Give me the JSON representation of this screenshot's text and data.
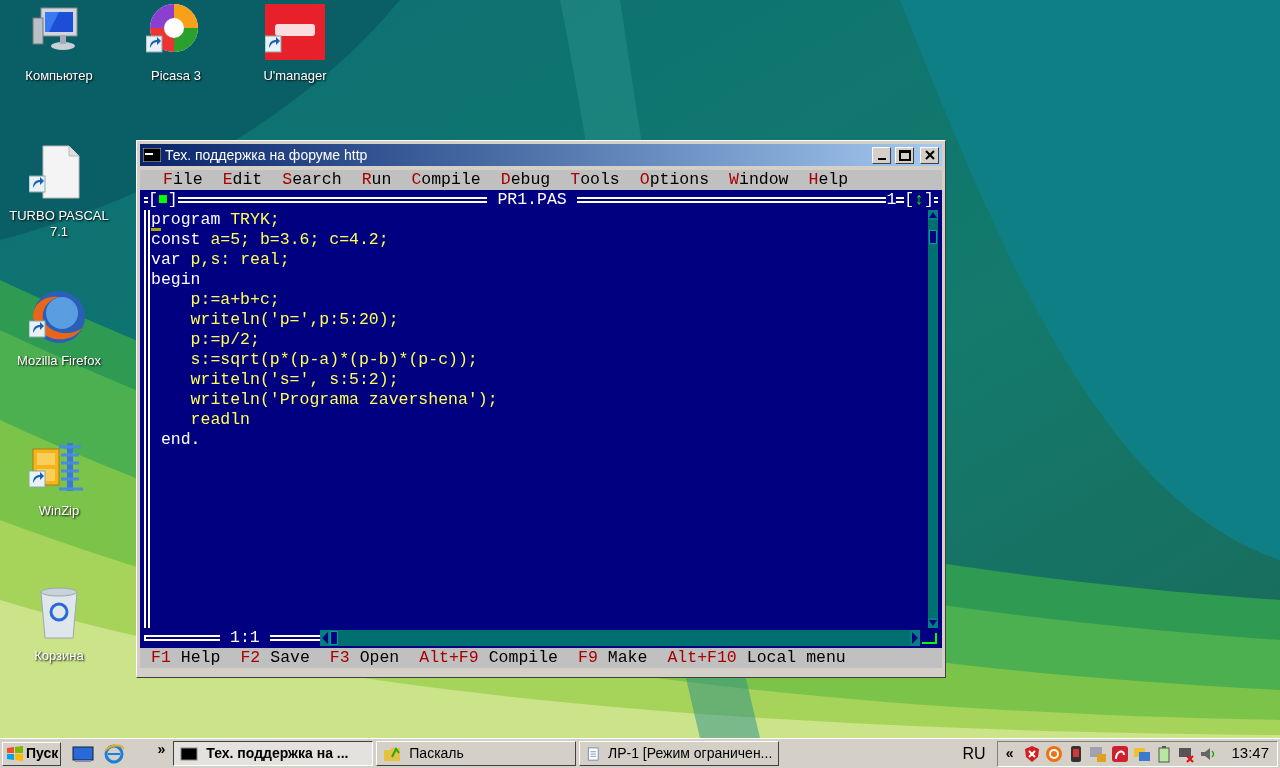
{
  "desktop_icons": [
    {
      "label": "Компьютер",
      "kind": "computer",
      "shortcut": false
    },
    {
      "label": "Picasa 3",
      "kind": "picasa",
      "shortcut": true
    },
    {
      "label": "U'manager",
      "kind": "utel",
      "shortcut": true
    },
    {
      "label": "TURBO PASCAL 7.1",
      "kind": "file",
      "shortcut": true
    },
    {
      "label": "Mozilla Firefox",
      "kind": "globe",
      "shortcut": true
    },
    {
      "label": "WinZip",
      "kind": "cabinet",
      "shortcut": true
    },
    {
      "label": "Корзина",
      "kind": "bin",
      "shortcut": false
    }
  ],
  "window": {
    "title": "Тех. поддержка на форуме http",
    "menu": [
      {
        "label": "File"
      },
      {
        "label": "Edit"
      },
      {
        "label": "Search"
      },
      {
        "label": "Run"
      },
      {
        "label": "Compile"
      },
      {
        "label": "Debug"
      },
      {
        "label": "Tools"
      },
      {
        "label": "Options"
      },
      {
        "label": "Window"
      },
      {
        "label": "Help"
      }
    ],
    "editor": {
      "close_box": "[■]",
      "title": "PR1.PAS",
      "window_number": "1",
      "zoom_box": "[↕]",
      "position": "1:1",
      "lines": [
        {
          "segments": [
            {
              "kind": "keyword",
              "text": "program"
            },
            {
              "kind": "text",
              "text": " TRYK;"
            }
          ]
        },
        {
          "segments": [
            {
              "kind": "keyword",
              "text": "const"
            },
            {
              "kind": "text",
              "text": " a=5; b=3.6; c=4.2;"
            }
          ]
        },
        {
          "segments": [
            {
              "kind": "keyword",
              "text": "var"
            },
            {
              "kind": "text",
              "text": " p,s: real;"
            }
          ]
        },
        {
          "segments": [
            {
              "kind": "keyword",
              "text": "begin"
            }
          ]
        },
        {
          "segments": [
            {
              "kind": "text",
              "text": "    p:=a+b+c;"
            }
          ]
        },
        {
          "segments": [
            {
              "kind": "text",
              "text": "    writeln('p=',p:5:20);"
            }
          ]
        },
        {
          "segments": [
            {
              "kind": "text",
              "text": "    p:=p/2;"
            }
          ]
        },
        {
          "segments": [
            {
              "kind": "text",
              "text": "    s:=sqrt(p*(p-a)*(p-b)*(p-c));"
            }
          ]
        },
        {
          "segments": [
            {
              "kind": "text",
              "text": "    writeln('s=', s:5:2);"
            }
          ]
        },
        {
          "segments": [
            {
              "kind": "text",
              "text": "    writeln('Programa zavershena');"
            }
          ]
        },
        {
          "segments": [
            {
              "kind": "text",
              "text": "    readln"
            }
          ]
        },
        {
          "segments": [
            {
              "kind": "keyword",
              "text": " end."
            }
          ]
        }
      ]
    },
    "status_line": [
      {
        "key": "F1",
        "label": "Help"
      },
      {
        "key": "F2",
        "label": "Save"
      },
      {
        "key": "F3",
        "label": "Open"
      },
      {
        "key": "Alt+F9",
        "label": "Compile"
      },
      {
        "key": "F9",
        "label": "Make"
      },
      {
        "key": "Alt+F10",
        "label": "Local menu"
      }
    ]
  },
  "taskbar": {
    "start_label": "Пуск",
    "quick_launch_more": "»",
    "tasks": [
      {
        "label": "Тех. поддержка на ...",
        "kind": "console",
        "selected": true
      },
      {
        "label": "Паскаль",
        "kind": "folder",
        "selected": false
      },
      {
        "label": "ЛР-1 [Режим ограничен...",
        "kind": "document",
        "selected": false
      }
    ],
    "language": "RU",
    "tray_toggle": "«",
    "clock": "13:47"
  }
}
